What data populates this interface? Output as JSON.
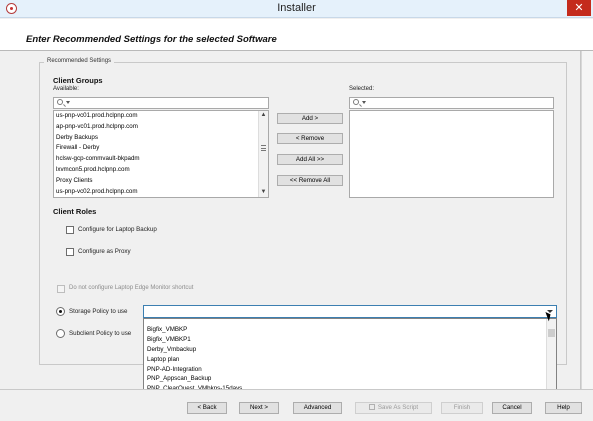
{
  "window": {
    "title": "Installer",
    "close_glyph": "✕"
  },
  "header": {
    "heading": "Enter Recommended Settings for the selected Software"
  },
  "recommended": {
    "legend": "Recommended Settings",
    "client_groups": {
      "title": "Client Groups",
      "available_label": "Available:",
      "selected_label": "Selected:",
      "available_items": [
        "us-pnp-vc01.prod.hclpnp.com",
        "ap-pnp-vc01.prod.hclpnp.com",
        "Derby Backups",
        "Firewall - Derby",
        "hclsw-gcp-commvault-bkpadm",
        "lxvmcon5.prod.hclpnp.com",
        "Proxy Clients",
        "us-pnp-vc02.prod.hclpnp.com"
      ],
      "selected_items": [],
      "buttons": {
        "add": "Add >",
        "remove": "< Remove",
        "add_all": "Add All >>",
        "remove_all": "<< Remove All"
      }
    },
    "client_roles": {
      "title": "Client Roles",
      "laptop_backup": "Configure for Laptop Backup",
      "proxy": "Configure as Proxy"
    },
    "edge_monitor": "Do not configure Laptop Edge Monitor shortcut",
    "storage_policy": {
      "label": "Storage Policy to use",
      "value": "",
      "options": [
        "Bigfix_VMBKP",
        "Bigfix_VMBKP1",
        "Derby_Vmbackup",
        "Laptop plan",
        "PNP-AD-Integration",
        "PNP_Appscan_Backup",
        "PNP_ClearQuest_VMbkps-15days"
      ]
    },
    "subclient_policy": {
      "label": "Subclient Policy to use"
    }
  },
  "footer": {
    "back": "< Back",
    "next": "Next >",
    "advanced": "Advanced",
    "save_script": "Save As Script",
    "finish": "Finish",
    "cancel": "Cancel",
    "help": "Help"
  },
  "colors": {
    "accent": "#3c7fb1",
    "close": "#c42b1c"
  }
}
